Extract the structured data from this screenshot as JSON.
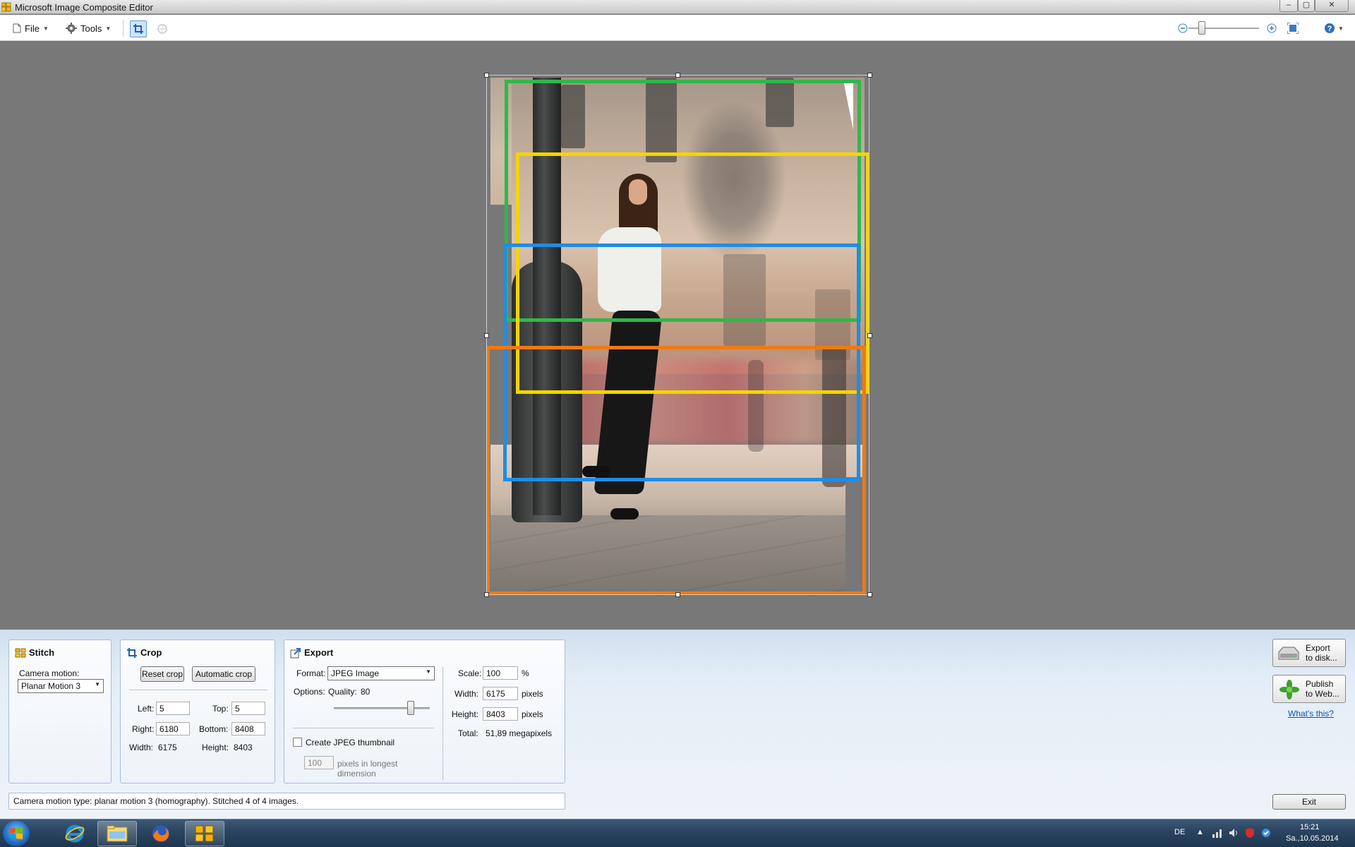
{
  "window": {
    "title": "Microsoft Image Composite Editor",
    "min": "–",
    "max": "▢",
    "close": "✕"
  },
  "toolbar": {
    "file_label": "File",
    "tools_label": "Tools"
  },
  "colors": {
    "green": "#2fb84a",
    "yellow": "#f4d400",
    "blue": "#1e8de8",
    "orange": "#f07a10"
  },
  "stitch": {
    "title": "Stitch",
    "camera_motion_label": "Camera motion:",
    "camera_motion_value": "Planar Motion 3"
  },
  "crop": {
    "title": "Crop",
    "reset_button": "Reset crop",
    "auto_button": "Automatic crop",
    "left_label": "Left:",
    "left_value": "5",
    "top_label": "Top:",
    "top_value": "5",
    "right_label": "Right:",
    "right_value": "6180",
    "bottom_label": "Bottom:",
    "bottom_value": "8408",
    "width_label": "Width:",
    "width_value": "6175",
    "height_label": "Height:",
    "height_value": "8403"
  },
  "export": {
    "title": "Export",
    "format_label": "Format:",
    "format_value": "JPEG Image",
    "options_label": "Options:",
    "quality_label": "Quality:",
    "quality_value": "80",
    "quality_slider_fraction": 0.8,
    "thumbnail_label": "Create JPEG thumbnail",
    "thumbnail_checked": false,
    "thumbnail_size": "100",
    "thumbnail_unit_line1": "pixels in longest",
    "thumbnail_unit_line2": "dimension",
    "scale_label": "Scale:",
    "scale_value": "100",
    "scale_unit": "%",
    "width_label": "Width:",
    "width_value": "6175",
    "width_unit": "pixels",
    "height_label": "Height:",
    "height_value": "8403",
    "height_unit": "pixels",
    "total_label": "Total:",
    "total_value": "51,89 megapixels"
  },
  "actions": {
    "export_line1": "Export",
    "export_line2": "to disk...",
    "publish_line1": "Publish",
    "publish_line2": "to Web...",
    "whats_this": "What's this?",
    "exit": "Exit"
  },
  "status": {
    "text": "Camera motion type: planar motion 3 (homography). Stitched 4 of 4 images."
  },
  "taskbar": {
    "language": "DE",
    "time": "15:21",
    "date": "Sa.,10.05.2014"
  }
}
